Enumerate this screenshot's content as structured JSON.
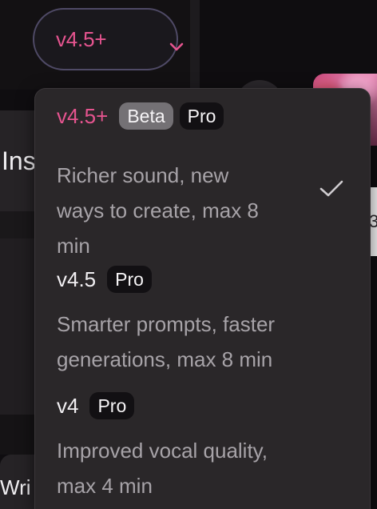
{
  "background": {
    "left_text_top": "Ins",
    "left_text_bottom": "Wri",
    "right_digit": "3"
  },
  "version_select": {
    "label": "v4.5+",
    "icon": "chevron-down-icon",
    "accent_color": "#e5548f"
  },
  "dropdown": {
    "items": [
      {
        "name": "v4.5+",
        "badges": [
          "Beta",
          "Pro"
        ],
        "description_lines": [
          "Richer sound, new",
          "ways to create, max 8",
          "min"
        ],
        "selected": true,
        "icon": "check-icon"
      },
      {
        "name": "v4.5",
        "badges": [
          "Pro"
        ],
        "description_lines": [
          "Smarter prompts, faster",
          "generations, max 8 min"
        ],
        "selected": false
      },
      {
        "name": "v4",
        "badges": [
          "Pro"
        ],
        "description_lines": [
          "Improved vocal quality,",
          "max 4 min"
        ],
        "selected": false
      }
    ]
  },
  "colors": {
    "accent_pink": "#e5548f",
    "menu_bg": "#2a2729",
    "muted_text": "#a7a3a8"
  }
}
